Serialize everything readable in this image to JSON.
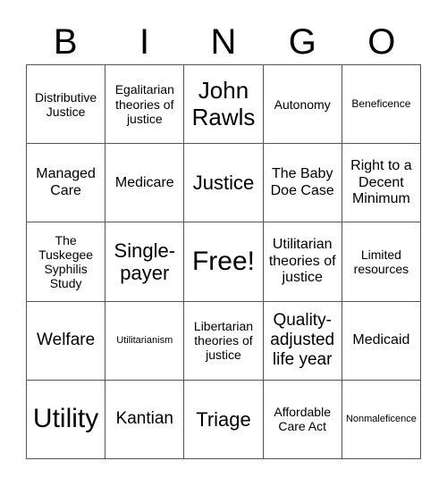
{
  "header": {
    "letters": [
      "B",
      "I",
      "N",
      "G",
      "O"
    ]
  },
  "board": {
    "rows": [
      [
        "Distributive Justice",
        "Egalitarian theories of justice",
        "John Rawls",
        "Autonomy",
        "Beneficence"
      ],
      [
        "Managed Care",
        "Medicare",
        "Justice",
        "The Baby Doe Case",
        "Right to a Decent Minimum"
      ],
      [
        "The Tuskegee Syphilis Study",
        "Single-payer",
        "Free!",
        "Utilitarian theories of justice",
        "Limited resources"
      ],
      [
        "Welfare",
        "Utilitarianism",
        "Libertarian theories of justice",
        "Quality-adjusted life year",
        "Medicaid"
      ],
      [
        "Utility",
        "Kantian",
        "Triage",
        "Affordable Care Act",
        "Nonmaleficence"
      ]
    ]
  }
}
